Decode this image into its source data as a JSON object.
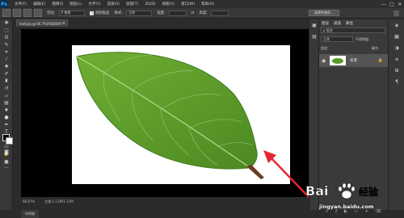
{
  "app": {
    "logo": "Ps"
  },
  "menu": {
    "items": [
      "文件(F)",
      "编辑(E)",
      "图像(I)",
      "图层(L)",
      "文字(Y)",
      "选择(S)",
      "滤镜(T)",
      "3D(D)",
      "视图(V)",
      "窗口(W)",
      "帮助(H)"
    ]
  },
  "window_controls": [
    "—",
    "□",
    "✕"
  ],
  "options": {
    "feather_label": "羽化:",
    "feather_value": "0 像素",
    "antialias_label": "消除锯齿",
    "style_label": "样式:",
    "style_value": "正常",
    "width_label": "宽度:",
    "height_label": "高度:",
    "select_mask_label": "选择并遮住..."
  },
  "document": {
    "tab_title": "leaf.jpg @ 66.7%(RGB/8#)",
    "close": "×"
  },
  "status": {
    "zoom": "66.67%",
    "doc_info": "文档:1.11M/1.11M"
  },
  "bottom_tab": "时间轴",
  "layers_panel": {
    "tabs": [
      "图层",
      "通道",
      "路径"
    ],
    "kind_label": "ρ 类型",
    "mode_value": "正常",
    "opacity_label": "不透明度:",
    "lock_label": "锁定:",
    "fill_label": "填充:",
    "layer_name": "背景"
  },
  "watermark": {
    "brand": "Bai",
    "brand2": "经验",
    "url": "jingyan.baidu.com"
  },
  "colors": {
    "accent": "#31a8ff",
    "arrow": "#e8262f",
    "leaf": "#5a9a2a"
  }
}
